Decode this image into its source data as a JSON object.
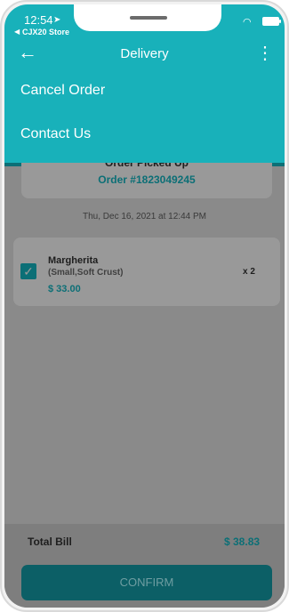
{
  "status_bar": {
    "time": "12:54",
    "location_icon": "location-arrow",
    "back_label": "◀",
    "store": "CJX20 Store",
    "wifi_icon": "wifi",
    "battery_icon": "battery"
  },
  "nav": {
    "title": "Delivery",
    "back_icon": "back-arrow",
    "more_icon": "more-vertical"
  },
  "menu": {
    "items": [
      "Cancel Order",
      "Contact Us"
    ]
  },
  "order": {
    "status": "Order Picked Up",
    "number": "Order #1823049245",
    "date": "Thu, Dec 16, 2021 at 12:44 PM"
  },
  "item": {
    "name": "Margherita",
    "options": "(Small,Soft Crust)",
    "price": "$ 33.00",
    "quantity": "x 2",
    "checked": true
  },
  "bill": {
    "label": "Total Bill",
    "value": "$ 38.83"
  },
  "confirm": {
    "label": "CONFIRM"
  },
  "colors": {
    "accent": "#18b1ba",
    "dark_teal": "#0c6f76"
  }
}
